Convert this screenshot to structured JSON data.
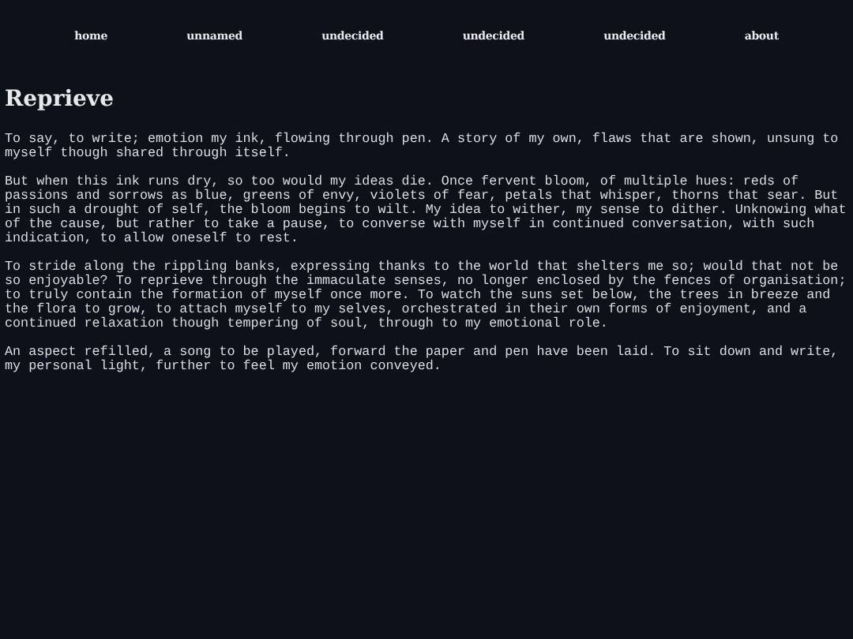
{
  "nav": [
    {
      "label": "home"
    },
    {
      "label": "unnamed"
    },
    {
      "label": "undecided"
    },
    {
      "label": "undecided"
    },
    {
      "label": "undecided"
    },
    {
      "label": "about"
    }
  ],
  "title": "Reprieve",
  "paragraphs": [
    "To say, to write; emotion my ink, flowing through pen. A story of my own, flaws that are shown, unsung to myself though shared through itself.",
    "But when this ink runs dry, so too would my ideas die. Once fervent bloom, of multiple hues: reds of passions and sorrows as blue, greens of envy, violets of fear, petals that whisper, thorns that sear. But in such a drought of self, the bloom begins to wilt. My idea to wither, my sense to dither. Unknowing what of the cause, but rather to take a pause, to converse with myself in continued conversation, with such indication, to allow oneself to rest.",
    "To stride along the rippling banks, expressing thanks to the world that shelters me so; would that not be so enjoyable? To reprieve through the immaculate senses, no longer enclosed by the fences of organisation; to truly contain the formation of myself once more. To watch the suns set below, the trees in breeze and the flora to grow, to attach myself to my selves, orchestrated in their own forms of enjoyment, and a continued relaxation though tempering of soul, through to my emotional role.",
    "An aspect refilled, a song to be played, forward the paper and pen have been laid. To sit down and write, my personal light, further to feel my emotion conveyed."
  ]
}
